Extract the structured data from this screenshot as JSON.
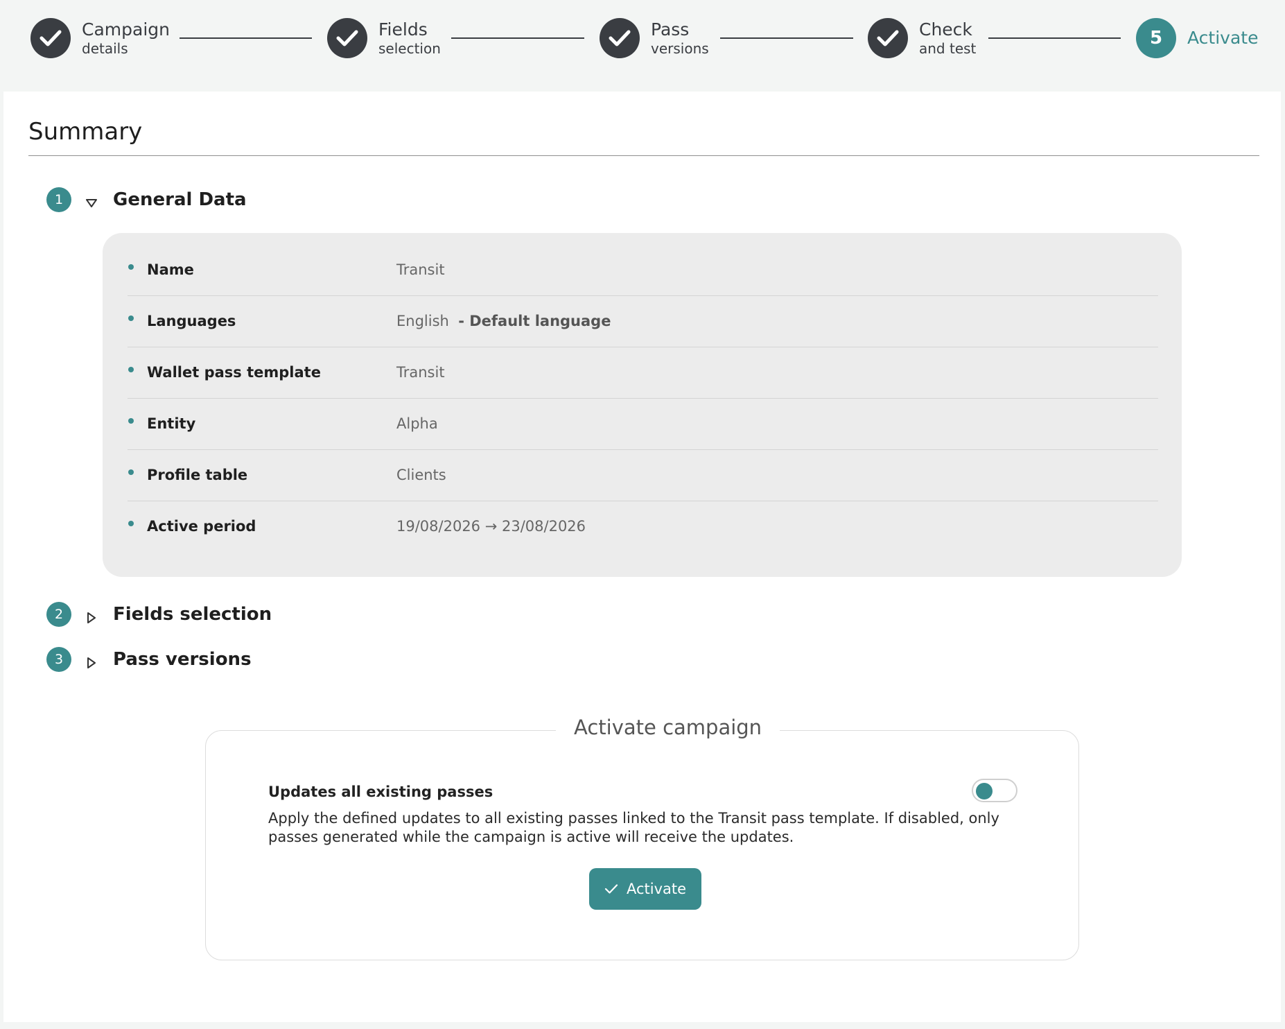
{
  "stepper": {
    "steps": [
      {
        "title": "Campaign",
        "subtitle": "details",
        "state": "done"
      },
      {
        "title": "Fields",
        "subtitle": "selection",
        "state": "done"
      },
      {
        "title": "Pass",
        "subtitle": "versions",
        "state": "done"
      },
      {
        "title": "Check",
        "subtitle": "and test",
        "state": "done"
      },
      {
        "number": "5",
        "title": "Activate",
        "state": "active"
      }
    ]
  },
  "summary": {
    "title": "Summary",
    "sections": [
      {
        "number": "1",
        "title": "General Data",
        "expanded": true
      },
      {
        "number": "2",
        "title": "Fields selection",
        "expanded": false
      },
      {
        "number": "3",
        "title": "Pass versions",
        "expanded": false
      }
    ],
    "general_data": [
      {
        "label": "Name",
        "value": "Transit"
      },
      {
        "label": "Languages",
        "value": "English",
        "extra": "- Default language"
      },
      {
        "label": "Wallet pass template",
        "value": "Transit"
      },
      {
        "label": "Entity",
        "value": "Alpha"
      },
      {
        "label": "Profile table",
        "value": "Clients"
      },
      {
        "label": "Active period",
        "value": "19/08/2026 → 23/08/2026"
      }
    ]
  },
  "activate": {
    "legend": "Activate campaign",
    "option_title": "Updates all existing passes",
    "option_description": "Apply the defined updates to all existing passes linked to the Transit pass template. If disabled, only passes generated while the campaign is active will receive the updates.",
    "toggle_on": false,
    "button_label": "Activate"
  },
  "colors": {
    "accent": "#3a8b8d",
    "done_step": "#3a3d42"
  }
}
